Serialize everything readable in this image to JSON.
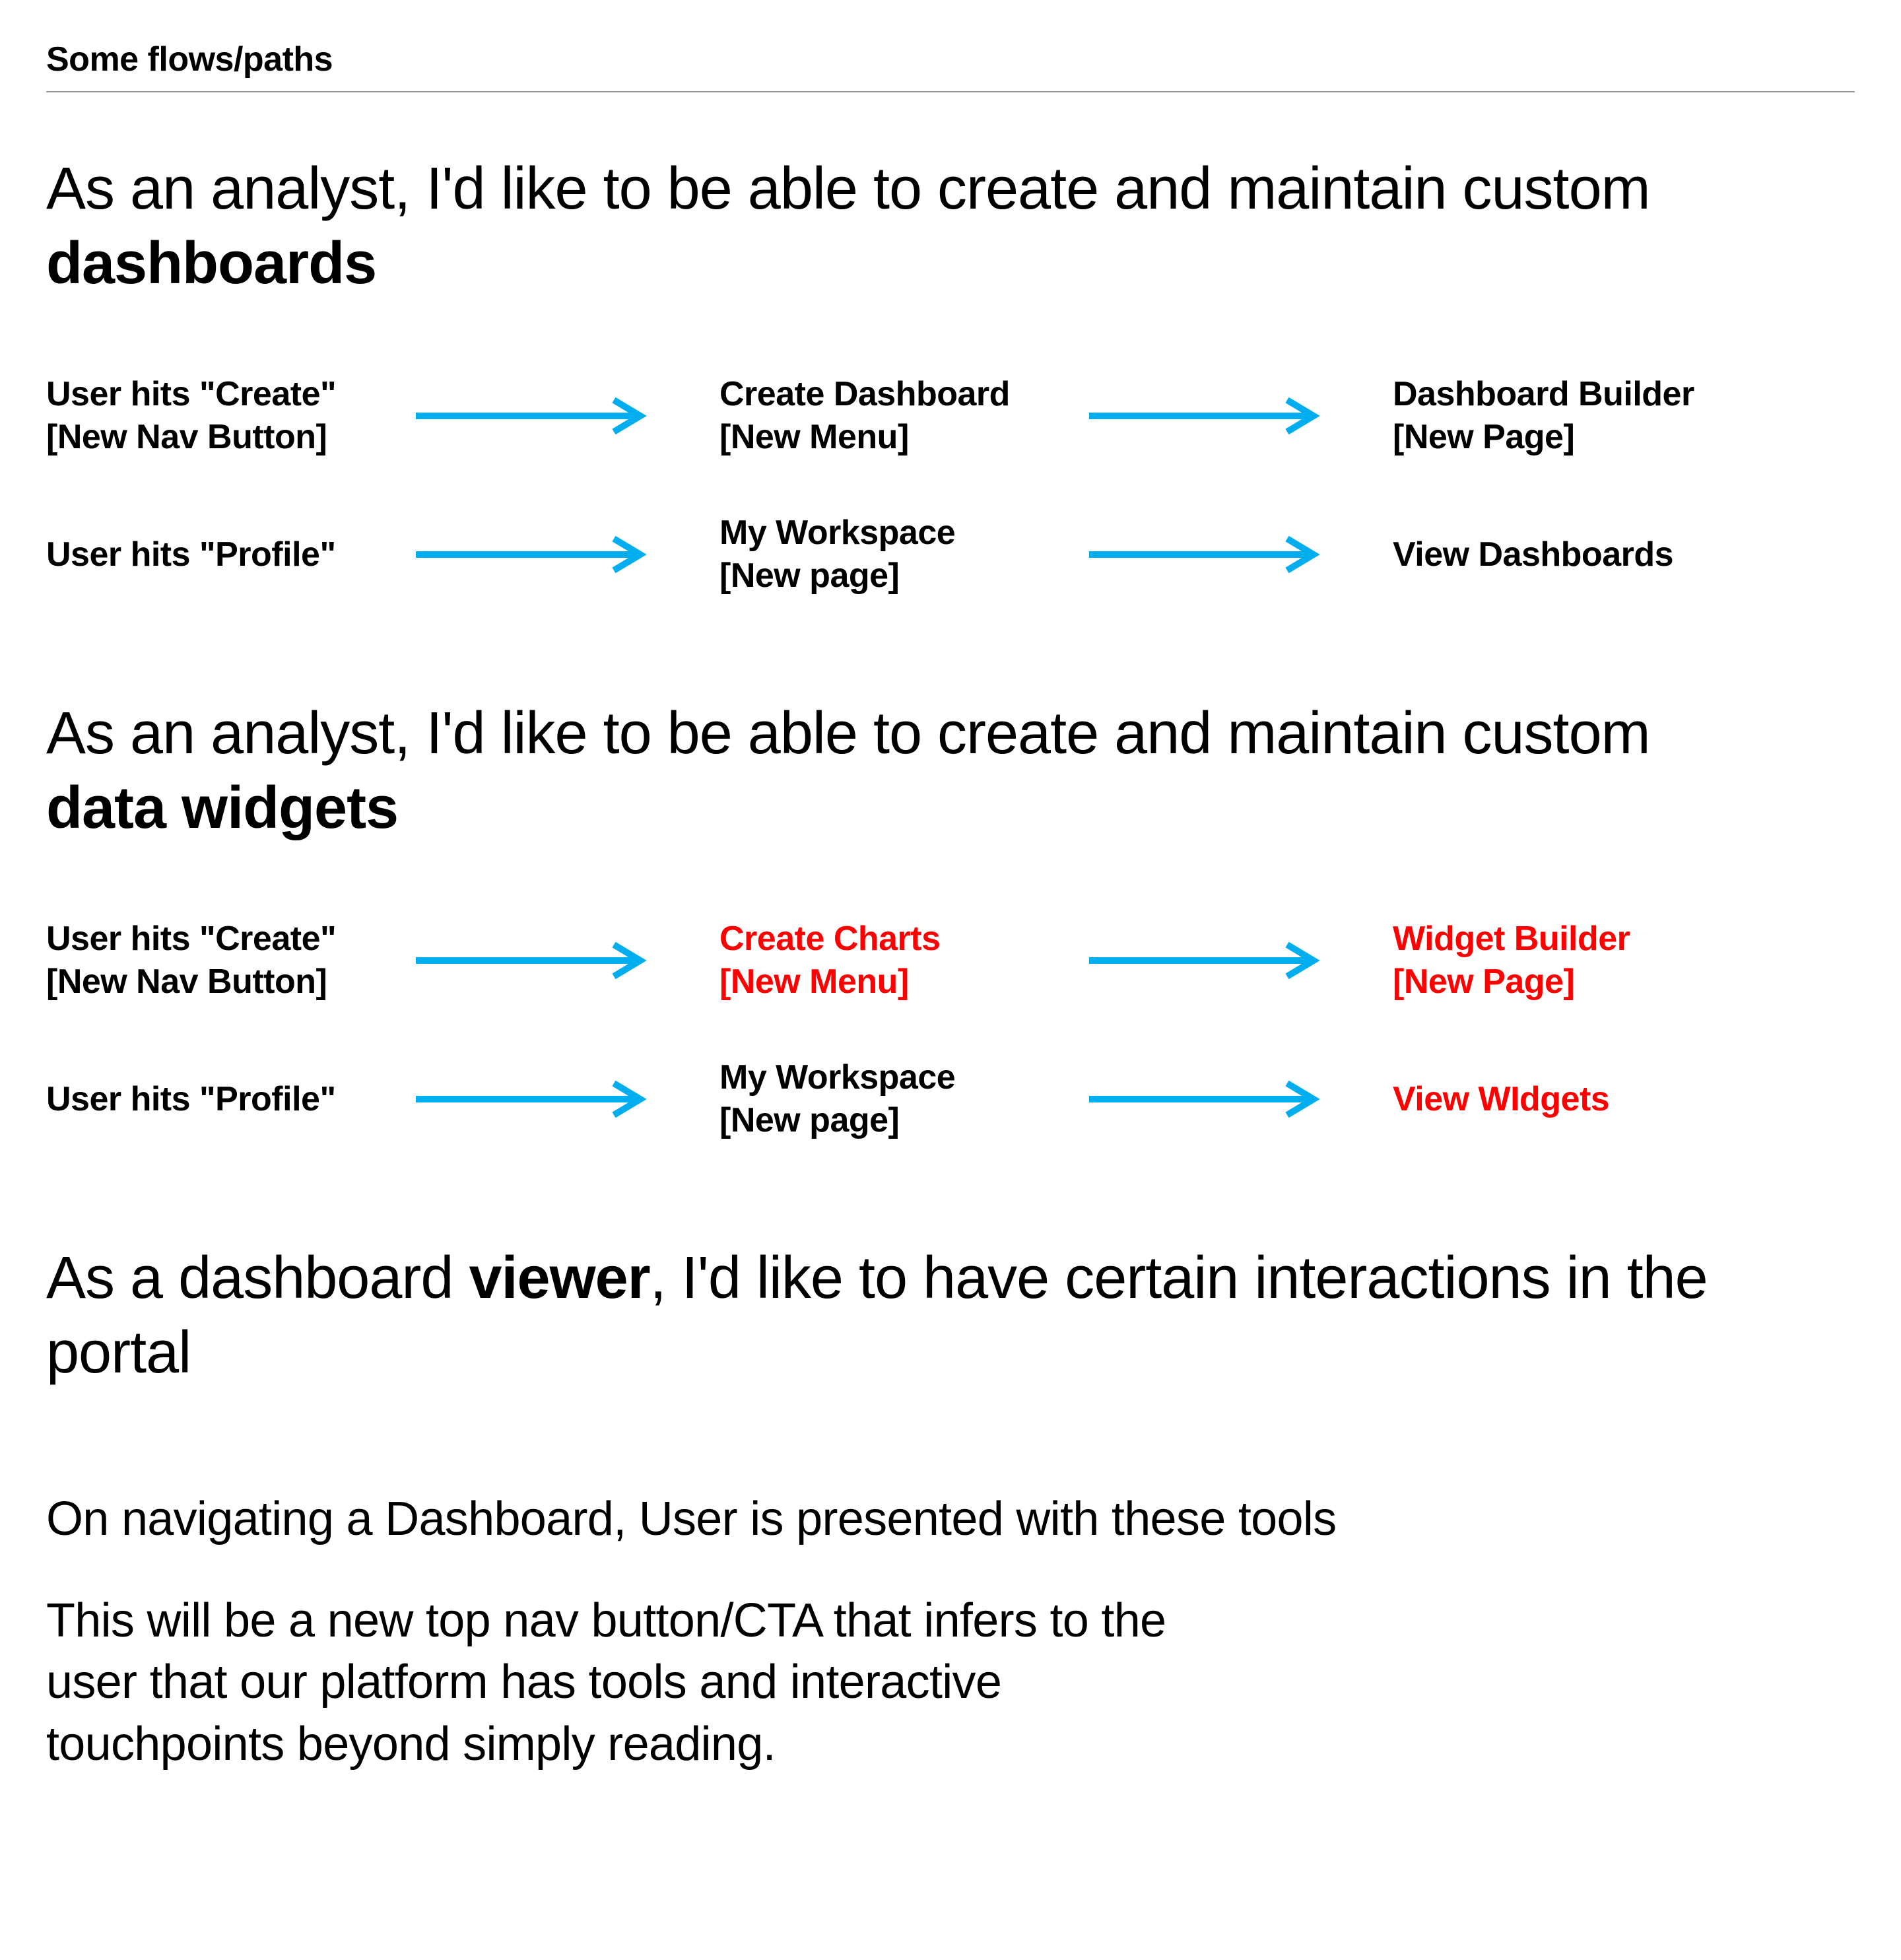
{
  "section_title": "Some flows/paths",
  "arrow_color": "#00aeef",
  "stories": [
    {
      "heading_prefix": "As an analyst, I'd like to be able to create and maintain custom ",
      "heading_bold": "dashboards",
      "heading_suffix": "",
      "flows": [
        {
          "steps": [
            {
              "text": "User hits \"Create\"\n[New Nav Button]",
              "red": false
            },
            {
              "text": "Create Dashboard\n[New Menu]",
              "red": false
            },
            {
              "text": "Dashboard Builder\n[New Page]",
              "red": false
            }
          ]
        },
        {
          "steps": [
            {
              "text": "User hits \"Profile\"",
              "red": false
            },
            {
              "text": "My Workspace\n[New page]",
              "red": false
            },
            {
              "text": "View Dashboards",
              "red": false
            }
          ]
        }
      ]
    },
    {
      "heading_prefix": "As an analyst, I'd like to be able to create and maintain custom ",
      "heading_bold": "data widgets",
      "heading_suffix": "",
      "flows": [
        {
          "steps": [
            {
              "text": "User hits \"Create\"\n[New Nav Button]",
              "red": false
            },
            {
              "text": "Create Charts\n[New Menu]",
              "red": true
            },
            {
              "text": "Widget Builder\n[New Page]",
              "red": true
            }
          ]
        },
        {
          "steps": [
            {
              "text": "User hits \"Profile\"",
              "red": false
            },
            {
              "text": "My Workspace\n[New page]",
              "red": false
            },
            {
              "text": "View WIdgets",
              "red": true
            }
          ]
        }
      ]
    },
    {
      "heading_prefix": "As a dashboard ",
      "heading_bold": "viewer",
      "heading_suffix": ", I'd like to have certain interactions in the portal",
      "flows": []
    }
  ],
  "notes": [
    "On navigating a Dashboard, User is presented with these tools",
    "This will be a new top nav button/CTA that infers to the user that our platform has tools and interactive touchpoints beyond simply reading."
  ]
}
